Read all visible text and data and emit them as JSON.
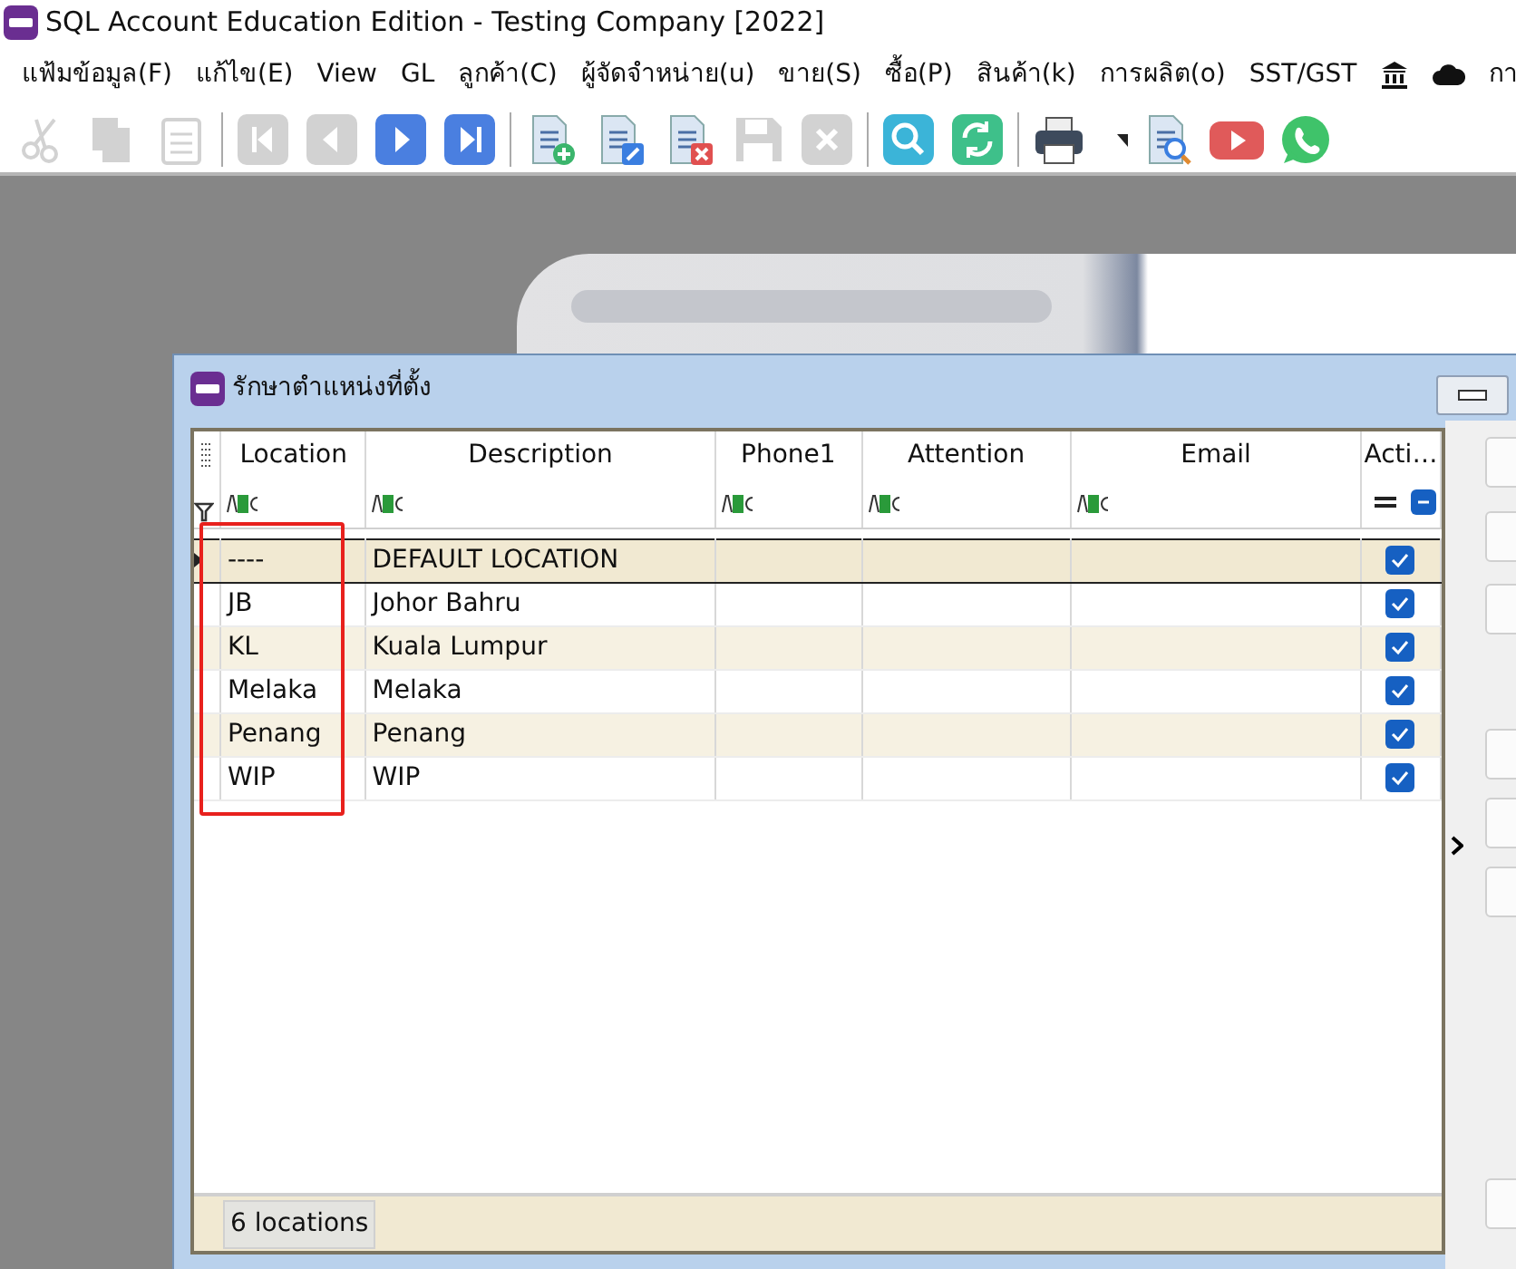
{
  "window": {
    "title": "SQL Account Education Edition - Testing Company [2022]"
  },
  "menu": [
    {
      "kind": "text",
      "label": "แฟ้มข้อมูล(F)"
    },
    {
      "kind": "text",
      "label": "แก้ไข(E)"
    },
    {
      "kind": "text",
      "label": "View"
    },
    {
      "kind": "text",
      "label": "GL"
    },
    {
      "kind": "text",
      "label": "ลูกค้า(C)"
    },
    {
      "kind": "text",
      "label": "ผู้จัดจำหน่าย(u)"
    },
    {
      "kind": "text",
      "label": "ขาย(S)"
    },
    {
      "kind": "text",
      "label": "ซื้อ(P)"
    },
    {
      "kind": "text",
      "label": "สินค้า(k)"
    },
    {
      "kind": "text",
      "label": "การผลิต(o)"
    },
    {
      "kind": "text",
      "label": "SST/GST"
    },
    {
      "kind": "bank"
    },
    {
      "kind": "cloud"
    },
    {
      "kind": "text",
      "label": "กา"
    }
  ],
  "toolbar": [
    {
      "kind": "cut",
      "disabled": true
    },
    {
      "kind": "copy",
      "disabled": true
    },
    {
      "kind": "paste",
      "disabled": true
    },
    {
      "kind": "separator"
    },
    {
      "kind": "first",
      "disabled": true
    },
    {
      "kind": "prior",
      "disabled": true
    },
    {
      "kind": "next",
      "disabled": false
    },
    {
      "kind": "last",
      "disabled": false
    },
    {
      "kind": "separator"
    },
    {
      "kind": "new",
      "disabled": false
    },
    {
      "kind": "edit",
      "disabled": false
    },
    {
      "kind": "delete",
      "disabled": false
    },
    {
      "kind": "save",
      "disabled": true
    },
    {
      "kind": "cancel",
      "disabled": true
    },
    {
      "kind": "separator"
    },
    {
      "kind": "search",
      "disabled": false
    },
    {
      "kind": "refresh",
      "disabled": false
    },
    {
      "kind": "separator"
    },
    {
      "kind": "print",
      "disabled": false
    },
    {
      "kind": "dropdown",
      "disabled": false
    },
    {
      "kind": "preview",
      "disabled": false
    },
    {
      "kind": "youtube",
      "disabled": false
    },
    {
      "kind": "whatsapp",
      "disabled": false
    }
  ],
  "child_window": {
    "title": "รักษาตำแหน่งที่ตั้ง",
    "table": {
      "columns": [
        "Location",
        "Description",
        "Phone1",
        "Attention",
        "Email",
        "Acti…"
      ],
      "rows": [
        {
          "location": "----",
          "description": "DEFAULT LOCATION",
          "active": true,
          "selected": true
        },
        {
          "location": "JB",
          "description": "Johor Bahru",
          "active": true,
          "selected": false
        },
        {
          "location": "KL",
          "description": "Kuala Lumpur",
          "active": true,
          "selected": false
        },
        {
          "location": "Melaka",
          "description": "Melaka",
          "active": true,
          "selected": false
        },
        {
          "location": "Penang",
          "description": "Penang",
          "active": true,
          "selected": false
        },
        {
          "location": "WIP",
          "description": "WIP",
          "active": true,
          "selected": false
        }
      ]
    },
    "footer": "6 locations"
  }
}
